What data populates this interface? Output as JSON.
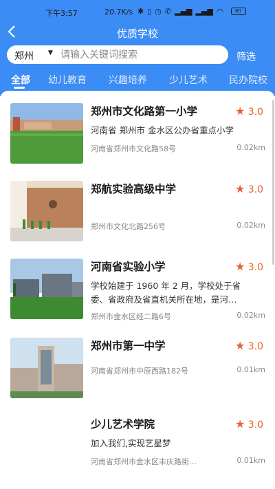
{
  "status": {
    "time": "下午3:57",
    "speed": "20.7K/s",
    "battery": "80"
  },
  "nav": {
    "title": "优质学校"
  },
  "search": {
    "city": "郑州",
    "placeholder": "请输入关键词搜索",
    "filter_label": "筛选"
  },
  "tabs": [
    "全部",
    "幼儿教育",
    "兴趣培养",
    "少儿艺术",
    "民办院校"
  ],
  "schools": [
    {
      "name": "郑州市文化路第一小学",
      "rating": "3.0",
      "desc": "河南省 郑州市 金水区公办省重点小学",
      "address": "河南省郑州市文化路58号",
      "distance": "0.02km"
    },
    {
      "name": "郑航实验高级中学",
      "rating": "3.0",
      "desc": "",
      "address": "郑州市文化北路256号",
      "distance": "0.02km"
    },
    {
      "name": "河南省实验小学",
      "rating": "3.0",
      "desc": "学校始建于 1960 年 2 月，学校处于省委、省政府及省直机关所在地，是河…",
      "address": "郑州市金水区经二路6号",
      "distance": "0.02km"
    },
    {
      "name": "郑州市第一中学",
      "rating": "3.0",
      "desc": "",
      "address": "河南省郑州市中原西路182号",
      "distance": "0.01km"
    },
    {
      "name": "少儿艺术学院",
      "rating": "3.0",
      "desc": "加入我们,实现艺星梦",
      "address": "河南省郑州市金水区丰庆路街…",
      "distance": "0.01km"
    }
  ],
  "colors": {
    "primary": "#3b8cf5",
    "rating": "#e8622b"
  }
}
